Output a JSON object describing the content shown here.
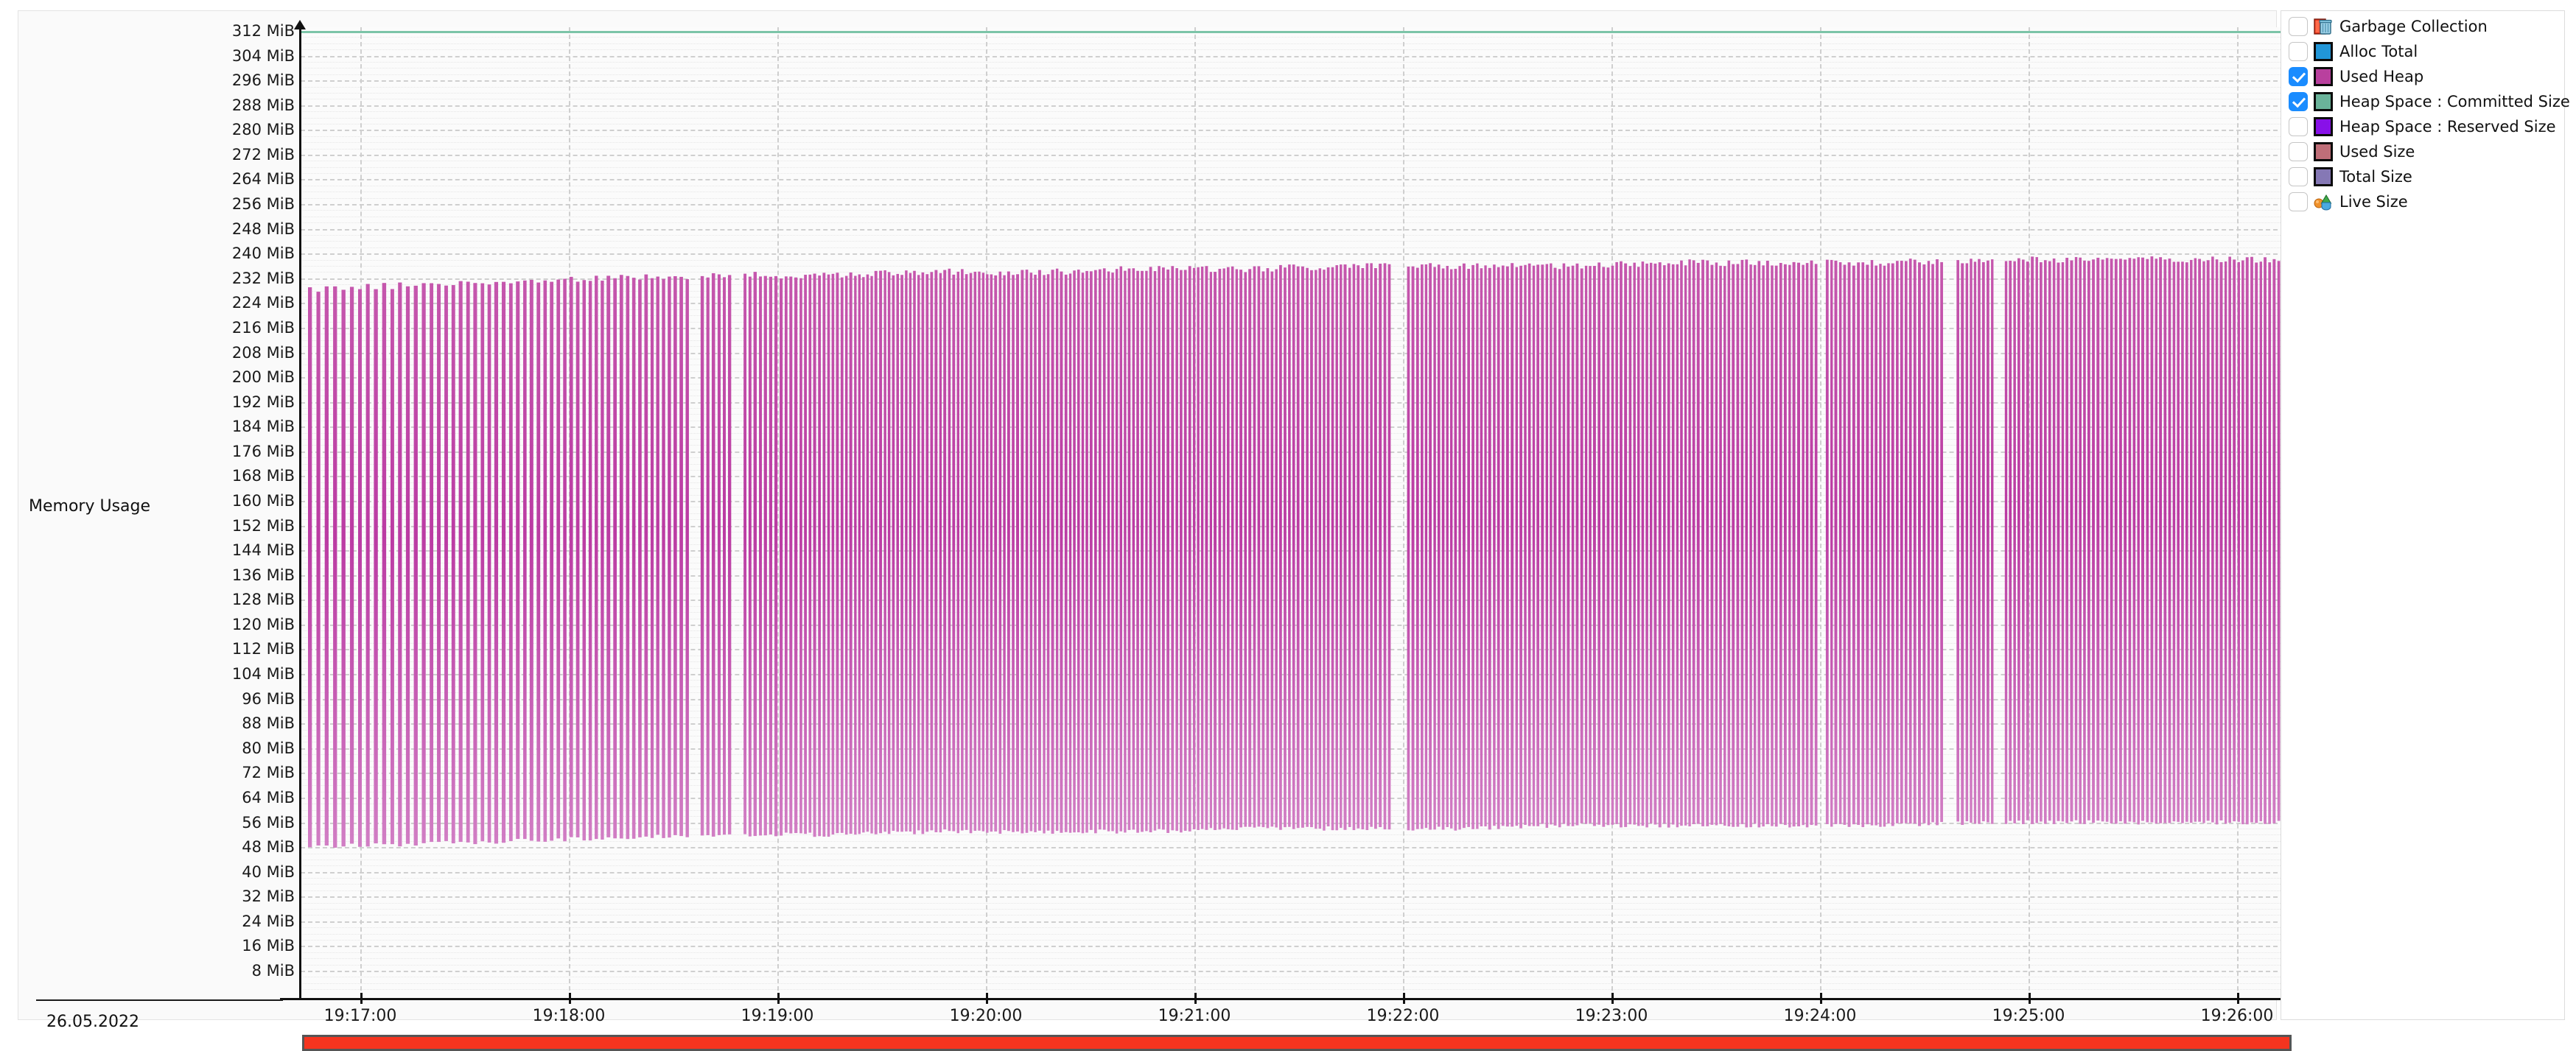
{
  "panel": {
    "row_label": "Memory Usage",
    "date_label": "26.05.2022"
  },
  "legend": {
    "items": [
      {
        "label": "Garbage Collection",
        "checked": false,
        "icon": "trash-bin-icon",
        "color": "#e8391f"
      },
      {
        "label": "Alloc Total",
        "checked": false,
        "icon": "swatch",
        "color": "#2196d8"
      },
      {
        "label": "Used Heap",
        "checked": true,
        "icon": "swatch",
        "color": "#b9409e"
      },
      {
        "label": "Heap Space : Committed Size",
        "checked": true,
        "icon": "swatch",
        "color": "#6ab39a"
      },
      {
        "label": "Heap Space : Reserved Size",
        "checked": false,
        "icon": "swatch",
        "color": "#8811e8"
      },
      {
        "label": "Used Size",
        "checked": false,
        "icon": "swatch",
        "color": "#bf6e78"
      },
      {
        "label": "Total Size",
        "checked": false,
        "icon": "swatch",
        "color": "#8578b5"
      },
      {
        "label": "Live Size",
        "checked": false,
        "icon": "live-size-icon",
        "color": "#f0912a"
      }
    ]
  },
  "chart_data": {
    "type": "area",
    "title": "Memory Usage",
    "xlabel": "",
    "ylabel": "Memory Usage",
    "date": "26.05.2022",
    "grid": true,
    "legend_position": "right",
    "ylim": [
      0,
      316
    ],
    "yunit": "MiB",
    "ytick_step": 8,
    "ytick_labels": [
      "312 MiB",
      "304 MiB",
      "296 MiB",
      "288 MiB",
      "280 MiB",
      "272 MiB",
      "264 MiB",
      "256 MiB",
      "248 MiB",
      "240 MiB",
      "232 MiB",
      "224 MiB",
      "216 MiB",
      "208 MiB",
      "200 MiB",
      "192 MiB",
      "184 MiB",
      "176 MiB",
      "168 MiB",
      "160 MiB",
      "152 MiB",
      "144 MiB",
      "136 MiB",
      "128 MiB",
      "120 MiB",
      "112 MiB",
      "104 MiB",
      "96 MiB",
      "88 MiB",
      "80 MiB",
      "72 MiB",
      "64 MiB",
      "56 MiB",
      "48 MiB",
      "40 MiB",
      "32 MiB",
      "24 MiB",
      "16 MiB",
      "8 MiB"
    ],
    "ytick_values": [
      312,
      304,
      296,
      288,
      280,
      272,
      264,
      256,
      248,
      240,
      232,
      224,
      216,
      208,
      200,
      192,
      184,
      176,
      168,
      160,
      152,
      144,
      136,
      128,
      120,
      112,
      104,
      96,
      88,
      80,
      72,
      64,
      56,
      48,
      40,
      32,
      24,
      16,
      8
    ],
    "xtick_labels": [
      "19:17:00",
      "19:18:00",
      "19:19:00",
      "19:20:00",
      "19:21:00",
      "19:22:00",
      "19:23:00",
      "19:24:00",
      "19:25:00",
      "19:26:00"
    ],
    "xrange": [
      "19:16:30",
      "19:26:15"
    ],
    "series": [
      {
        "name": "Heap Space : Committed Size",
        "color": "#7cc4a8",
        "type": "line",
        "constant_value": 312,
        "unit": "MiB"
      },
      {
        "name": "Used Heap",
        "color": "#b9409e",
        "type": "sawtooth-area",
        "unit": "MiB",
        "peak_start": 228,
        "peak_end": 238,
        "trough_start": 48,
        "trough_end": 56,
        "description": "Dense GC sawtooth: allocation ramps to a peak then drops to the trough on each collection cycle",
        "envelope_peaks": [
          228,
          230,
          231,
          232,
          233,
          233,
          234,
          234,
          235,
          235,
          236,
          236,
          236,
          237,
          237,
          237,
          238,
          238,
          238,
          238
        ],
        "envelope_troughs": [
          48,
          49,
          50,
          51,
          52,
          52,
          53,
          53,
          53,
          54,
          54,
          54,
          55,
          55,
          55,
          55,
          56,
          56,
          56,
          56
        ]
      }
    ]
  }
}
